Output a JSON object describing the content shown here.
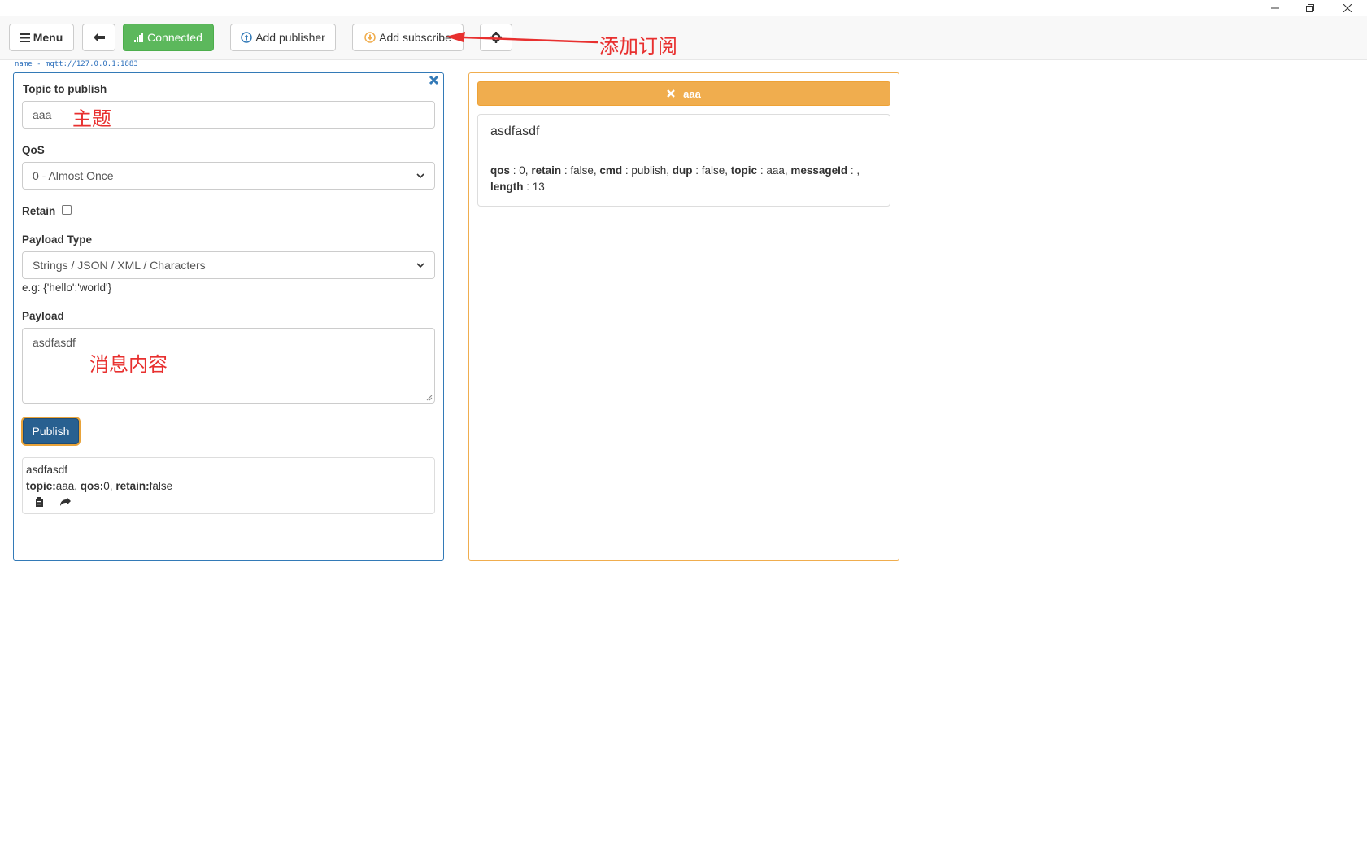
{
  "window": {
    "minimize_icon": "minimize-icon",
    "restore_icon": "restore-icon",
    "close_icon": "close-icon"
  },
  "toolbar": {
    "menu_label": "Menu",
    "back_icon": "arrow-left-icon",
    "connected_label": "Connected",
    "add_publisher_label": "Add publisher",
    "add_subscriber_label": "Add subscribe",
    "settings_icon": "gear-icon"
  },
  "connection": {
    "label": "name - mqtt://127.0.0.1:1883"
  },
  "publisher": {
    "topic_label": "Topic to publish",
    "topic_value": "aaa",
    "qos_label": "QoS",
    "qos_value": "0 - Almost Once",
    "retain_label": "Retain",
    "retain_checked": false,
    "payload_type_label": "Payload Type",
    "payload_type_value": "Strings / JSON / XML / Characters",
    "payload_hint": "e.g: {'hello':'world'}",
    "payload_label": "Payload",
    "payload_value": "asdfasdf",
    "publish_label": "Publish",
    "history": {
      "message": "asdfasdf",
      "topic_key": "topic:",
      "topic_val": "aaa,",
      "qos_key": "qos:",
      "qos_val": "0,",
      "retain_key": "retain:",
      "retain_val": "false"
    }
  },
  "subscriber": {
    "topic": "aaa",
    "message": {
      "payload": "asdfasdf",
      "qos_key": "qos",
      "qos_val": ": 0,",
      "retain_key": "retain",
      "retain_val": ": false,",
      "cmd_key": "cmd",
      "cmd_val": ": publish,",
      "dup_key": "dup",
      "dup_val": ": false,",
      "topic_key": "topic",
      "topic_val": ": aaa,",
      "messageid_key": "messageId",
      "messageid_val": ": ,",
      "length_key": "length",
      "length_val": ": 13"
    }
  },
  "annotations": {
    "add_subscription": "添加订阅",
    "topic": "主题",
    "payload": "消息内容"
  },
  "colors": {
    "primary": "#337ab7",
    "success": "#5cb85c",
    "warning": "#f0ad4e",
    "annotation": "#e8302f"
  }
}
